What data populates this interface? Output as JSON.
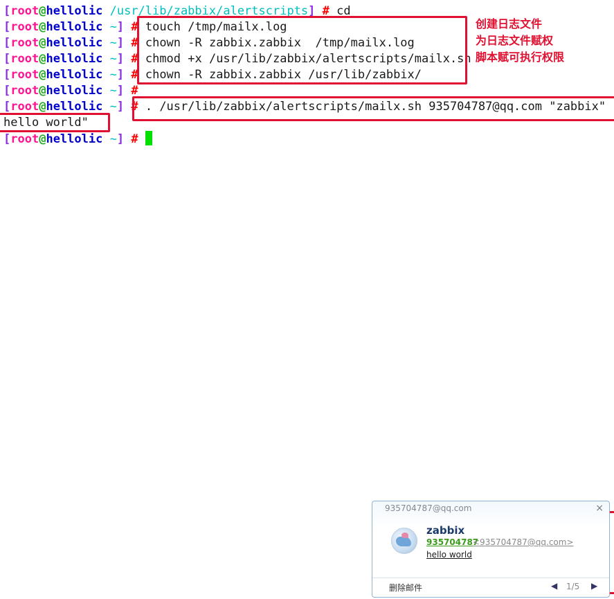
{
  "prompt": {
    "open": "[",
    "user": "root",
    "at": "@",
    "host": "hellolic",
    "close": "]",
    "symbol": "#"
  },
  "lines": [
    {
      "path": "/usr/lib/zabbix/alertscripts",
      "cmd": "cd"
    },
    {
      "path": "~",
      "cmd": "touch /tmp/mailx.log"
    },
    {
      "path": "~",
      "cmd": "chown -R zabbix.zabbix  /tmp/mailx.log"
    },
    {
      "path": "~",
      "cmd": "chmod +x /usr/lib/zabbix/alertscripts/mailx.sh"
    },
    {
      "path": "~",
      "cmd": "chown -R zabbix.zabbix /usr/lib/zabbix/"
    },
    {
      "path": "~",
      "cmd": ""
    },
    {
      "path": "~",
      "cmd": ". /usr/lib/zabbix/alertscripts/mailx.sh 935704787@qq.com \"zabbix\" \""
    },
    {
      "path": "",
      "cmd": "hello world\""
    },
    {
      "path": "~",
      "cmd": ""
    }
  ],
  "annotations": [
    "创建日志文件",
    "为日志文件赋权",
    "脚本赋可执行权限"
  ],
  "notification": {
    "account": "935704787@qq.com",
    "close_glyph": "×",
    "sender": "zabbix",
    "from_name": "935704787",
    "from_address": "<935704787@qq.com>",
    "subject": "hello world",
    "delete_label": "删除邮件",
    "prev_glyph": "◀",
    "page": "1/5",
    "next_glyph": "▶"
  },
  "colors": {
    "annotation_red": "#e01030",
    "cursor_green": "#00e000"
  }
}
